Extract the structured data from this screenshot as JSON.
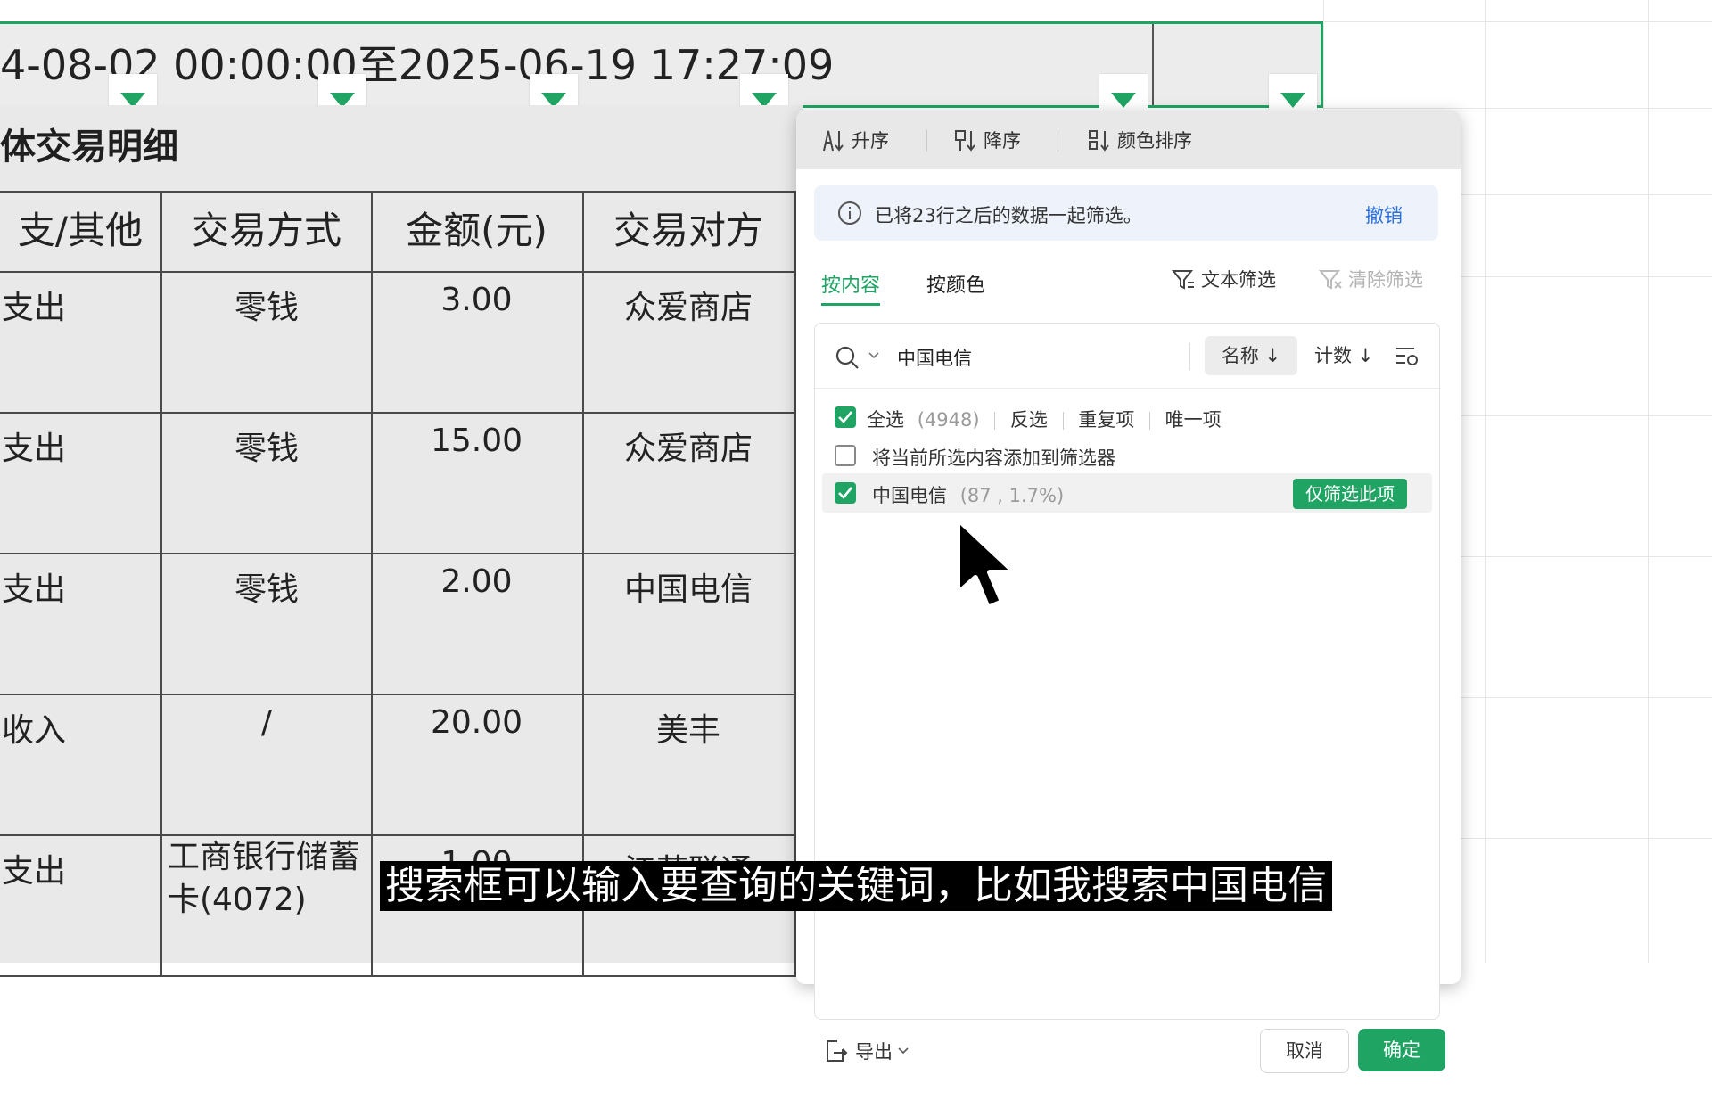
{
  "header": {
    "date_range": "4-08-02 00:00:00至2025-06-19 17:27:09"
  },
  "sheet": {
    "title": "体交易明细",
    "columns": [
      "支/其他",
      "交易方式",
      "金额(元)",
      "交易对方"
    ],
    "rows": [
      [
        "支出",
        "零钱",
        "3.00",
        "众爱商店"
      ],
      [
        "支出",
        "零钱",
        "15.00",
        "众爱商店"
      ],
      [
        "支出",
        "零钱",
        "2.00",
        "中国电信"
      ],
      [
        "收入",
        "/",
        "20.00",
        "美丰"
      ],
      [
        "支出",
        "工商银行储蓄卡(4072)",
        "1.00",
        "江苏联通"
      ]
    ]
  },
  "filter_panel": {
    "sort": {
      "asc_label": "升序",
      "desc_label": "降序",
      "color_label": "颜色排序"
    },
    "notice": {
      "text": "已将23行之后的数据一起筛选。",
      "undo_label": "撤销"
    },
    "tabs": {
      "by_content": "按内容",
      "by_color": "按颜色"
    },
    "text_filter_label": "文本筛选",
    "clear_filter_label": "清除筛选",
    "search": {
      "value": "中国电信",
      "name_sort_label": "名称 ↓",
      "count_sort_label": "计数 ↓"
    },
    "options": {
      "select_all_label": "全选",
      "select_all_count": "(4948)",
      "invert_label": "反选",
      "duplicates_label": "重复项",
      "unique_label": "唯一项",
      "add_to_filter_label": "将当前所选内容添加到筛选器"
    },
    "item": {
      "label": "中国电信",
      "stats": "(87 , 1.7%)",
      "only_this_label": "仅筛选此项"
    },
    "footer": {
      "export_label": "导出",
      "cancel_label": "取消",
      "ok_label": "确定"
    }
  },
  "subtitle": "搜索框可以输入要查询的关键词，比如我搜索中国电信",
  "colors": {
    "accent": "#1fa463",
    "link": "#2b6fdb"
  }
}
